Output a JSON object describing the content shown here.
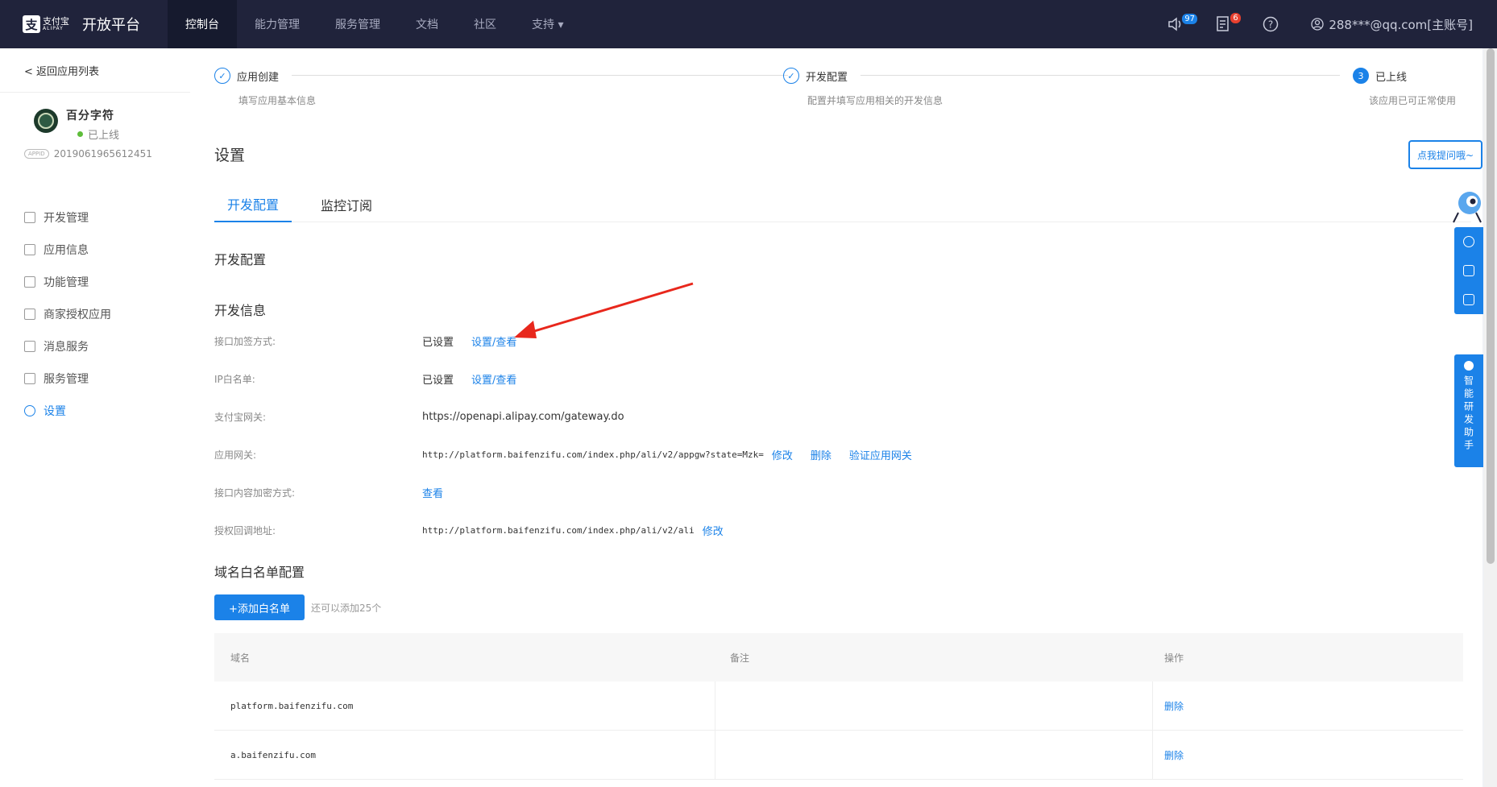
{
  "topbar": {
    "logo_text": "支付宝",
    "logo_sub": "ALIPAY",
    "title": "开放平台",
    "nav": [
      {
        "label": "控制台",
        "active": true
      },
      {
        "label": "能力管理"
      },
      {
        "label": "服务管理"
      },
      {
        "label": "文档"
      },
      {
        "label": "社区"
      },
      {
        "label": "支持 ▾"
      }
    ],
    "notice_count": "97",
    "message_count": "6",
    "account": "288***@qq.com[主账号]"
  },
  "sidebar": {
    "back": "< 返回应用列表",
    "app_name": "百分字符",
    "app_status": "已上线",
    "appid_tag": "APPID",
    "appid": "2019061965612451",
    "menu": [
      {
        "label": "开发管理",
        "icon": "layers-icon"
      },
      {
        "label": "应用信息",
        "icon": "grid-icon"
      },
      {
        "label": "功能管理",
        "icon": "list-icon"
      },
      {
        "label": "商家授权应用",
        "icon": "user-icon"
      },
      {
        "label": "消息服务",
        "icon": "monitor-icon"
      },
      {
        "label": "服务管理",
        "icon": "table-icon"
      },
      {
        "label": "设置",
        "icon": "gear-icon",
        "active": true
      }
    ]
  },
  "steps": [
    {
      "title": "应用创建",
      "desc": "填写应用基本信息",
      "mark": "✓"
    },
    {
      "title": "开发配置",
      "desc": "配置并填写应用相关的开发信息",
      "mark": "✓"
    },
    {
      "title": "已上线",
      "desc": "该应用已可正常使用",
      "mark": "3"
    }
  ],
  "page_title": "设置",
  "tabs": [
    "开发配置",
    "监控订阅"
  ],
  "dev_config_title": "开发配置",
  "dev_info_title": "开发信息",
  "dev_info": {
    "sign_label": "接口加签方式:",
    "sign_value": "已设置",
    "sign_link": "设置/查看",
    "ip_label": "IP白名单:",
    "ip_value": "已设置",
    "ip_link": "设置/查看",
    "gateway_label": "支付宝网关:",
    "gateway_value": "https://openapi.alipay.com/gateway.do",
    "app_gateway_label": "应用网关:",
    "app_gateway_value": "http://platform.baifenzifu.com/index.php/ali/v2/appgw?state=Mzk=",
    "app_gateway_edit": "修改",
    "app_gateway_delete": "删除",
    "app_gateway_verify": "验证应用网关",
    "encrypt_label": "接口内容加密方式:",
    "encrypt_link": "查看",
    "callback_label": "授权回调地址:",
    "callback_value": "http://platform.baifenzifu.com/index.php/ali/v2/ali",
    "callback_edit": "修改"
  },
  "whitelist": {
    "title": "域名白名单配置",
    "add_button": "+添加白名单",
    "tip": "还可以添加25个",
    "columns": [
      "域名",
      "备注",
      "操作"
    ],
    "rows": [
      {
        "domain": "platform.baifenzifu.com",
        "note": "",
        "action": "删除"
      },
      {
        "domain": "a.baifenzifu.com",
        "note": "",
        "action": "删除"
      }
    ]
  },
  "helper": {
    "ask": "点我提问哦~",
    "assistant": "智能研发助手"
  }
}
